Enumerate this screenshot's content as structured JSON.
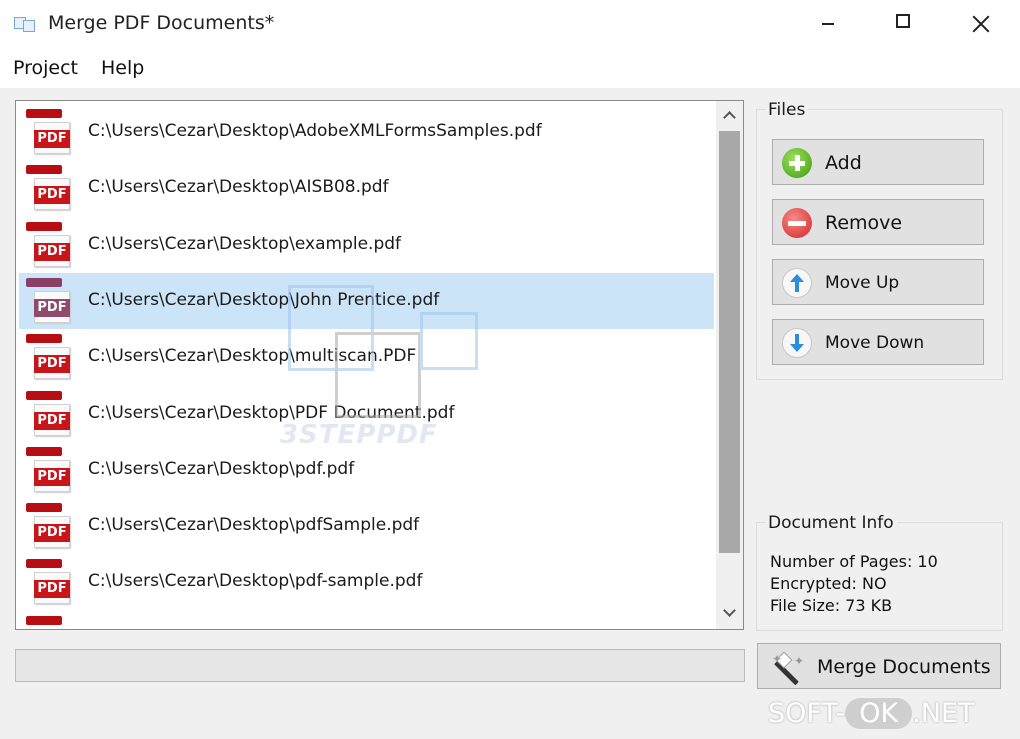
{
  "window": {
    "title": "Merge PDF Documents*"
  },
  "menu": {
    "items": [
      {
        "label": "Project"
      },
      {
        "label": "Help"
      }
    ]
  },
  "file_list": {
    "icon_badge": "PDF",
    "selected_index": 3,
    "items": [
      {
        "path": "C:\\Users\\Cezar\\Desktop\\AdobeXMLFormsSamples.pdf"
      },
      {
        "path": "C:\\Users\\Cezar\\Desktop\\AISB08.pdf"
      },
      {
        "path": "C:\\Users\\Cezar\\Desktop\\example.pdf"
      },
      {
        "path": "C:\\Users\\Cezar\\Desktop\\John Prentice.pdf"
      },
      {
        "path": "C:\\Users\\Cezar\\Desktop\\multiscan.PDF"
      },
      {
        "path": "C:\\Users\\Cezar\\Desktop\\PDF Document.pdf"
      },
      {
        "path": "C:\\Users\\Cezar\\Desktop\\pdf.pdf"
      },
      {
        "path": "C:\\Users\\Cezar\\Desktop\\pdfSample.pdf"
      },
      {
        "path": "C:\\Users\\Cezar\\Desktop\\pdf-sample.pdf"
      }
    ]
  },
  "watermark": {
    "text": "3STEPPDF"
  },
  "files_group": {
    "title": "Files",
    "add_label": "Add",
    "remove_label": "Remove",
    "move_up_label": "Move Up",
    "move_down_label": "Move Down"
  },
  "document_info": {
    "title": "Document Info",
    "pages": "Number of Pages: 10",
    "encrypted": "Encrypted: NO",
    "file_size": "File Size: 73 KB"
  },
  "merge_button": {
    "label": "Merge Documents"
  },
  "site_watermark": {
    "left": "SOFT-",
    "middle": "OK",
    "right": ".NET"
  },
  "colors": {
    "selection": "#cce4f7",
    "pdf_red": "#c8151a",
    "window_bg": "#f0f0f0"
  }
}
